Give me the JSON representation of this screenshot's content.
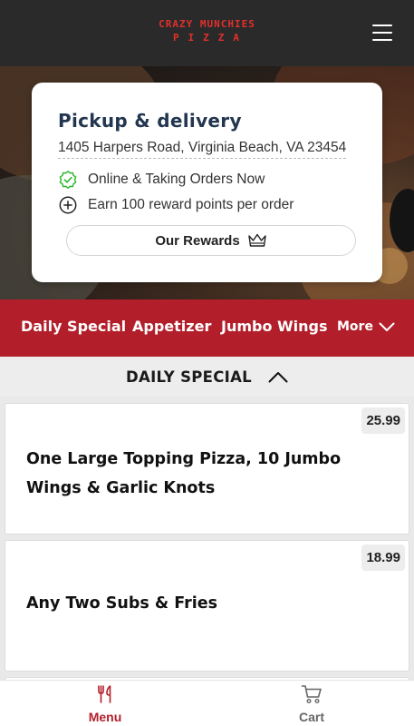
{
  "brand": {
    "line1": "CRAZY MUNCHIES",
    "line2": "PIZZA"
  },
  "info": {
    "title": "Pickup & delivery",
    "address": "1405 Harpers Road, Virginia Beach, VA 23454",
    "status": "Online & Taking Orders Now",
    "rewards_text": "Earn 100 reward points per order",
    "rewards_button": "Our Rewards"
  },
  "categories": [
    "Daily Special",
    "Appetizer",
    "Jumbo Wings"
  ],
  "more_label": "More",
  "section": {
    "title": "DAILY SPECIAL"
  },
  "items": [
    {
      "name": "One Large Topping Pizza, 10 Jumbo Wings & Garlic Knots",
      "price": "25.99"
    },
    {
      "name": "Any Two Subs & Fries",
      "price": "18.99"
    }
  ],
  "nav": {
    "menu": "Menu",
    "cart": "Cart"
  },
  "colors": {
    "accent": "#b21f2b",
    "logo": "#e0302c",
    "topbar": "#2a2a2a",
    "success": "#2eb82e"
  },
  "icons": [
    "hamburger-icon",
    "check-badge-icon",
    "plus-circle-icon",
    "crown-icon",
    "chevron-down-icon",
    "chevron-up-icon",
    "fork-knife-icon",
    "cart-icon"
  ]
}
